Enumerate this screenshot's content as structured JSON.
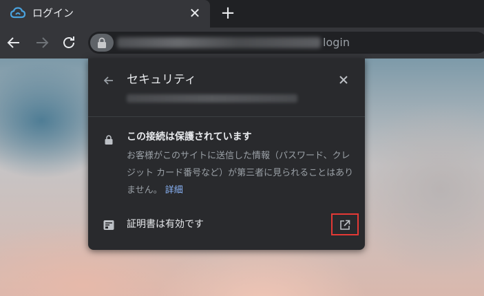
{
  "tab": {
    "title": "ログイン",
    "icon": "cloud-icon"
  },
  "toolbar": {
    "url_suffix": "login"
  },
  "popup": {
    "title": "セキュリティ",
    "connection_heading": "この接続は保護されています",
    "connection_desc": "お客様がこのサイトに送信した情報（パスワード、クレジット カード番号など）が第三者に見られることはありません。",
    "details_link": "詳細",
    "cert_label": "証明書は有効です"
  },
  "colors": {
    "accent": "#8ab4f8",
    "highlight": "#e53935",
    "tab_icon": "#4aa3df"
  }
}
